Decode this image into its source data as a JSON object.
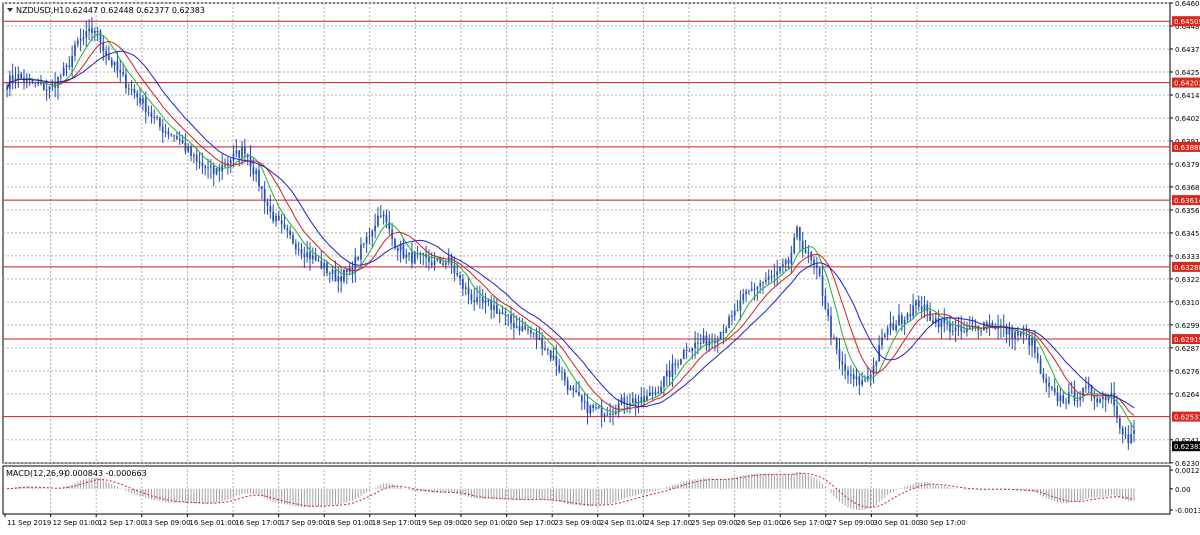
{
  "header": {
    "symbol_label": "NZDUSD,H1",
    "ohlc": "0.62447 0.62448 0.62377 0.62383"
  },
  "macd_header": {
    "label": "MACD(12,26,9)",
    "values": "-0.000843 -0.000663"
  },
  "colors": {
    "background": "#ffffff",
    "grid": "#b0b0b0",
    "candles": "#1f4fb4",
    "ma_fast": "#2bb02b",
    "ma_mid": "#d02020",
    "ma_slow": "#2020c0",
    "level_line": "#c81e1e",
    "level_tag_bg": "#d8281e",
    "current_tag_bg": "#000000",
    "macd_hist": "#a0a0a0",
    "macd_signal": "#d02020"
  },
  "chart_data": [
    {
      "type": "candlestick",
      "symbol": "NZDUSD",
      "timeframe": "H1",
      "ylim": [
        0.62299,
        0.646
      ],
      "y_ticks": [
        "0.64600",
        "0.64485",
        "0.64370",
        "0.64255",
        "0.64140",
        "0.64025",
        "0.63910",
        "0.63795",
        "0.63680",
        "0.63565",
        "0.63450",
        "0.63335",
        "0.63220",
        "0.63105",
        "0.62990",
        "0.62875",
        "0.62760",
        "0.62645",
        "0.62415",
        "0.62300"
      ],
      "x_ticks": [
        "11 Sep 2019",
        "12 Sep 01:00",
        "12 Sep 17:00",
        "13 Sep 09:00",
        "16 Sep 01:00",
        "16 Sep 17:00",
        "17 Sep 09:00",
        "18 Sep 01:00",
        "18 Sep 17:00",
        "19 Sep 09:00",
        "20 Sep 01:00",
        "20 Sep 17:00",
        "23 Sep 09:00",
        "24 Sep 01:00",
        "24 Sep 17:00",
        "25 Sep 09:00",
        "26 Sep 01:00",
        "26 Sep 17:00",
        "27 Sep 09:00",
        "30 Sep 01:00",
        "30 Sep 17:00"
      ],
      "horizontal_levels": [
        "0.64509",
        "0.64202",
        "0.63880",
        "0.63614",
        "0.63280",
        "0.62919",
        "0.62531"
      ],
      "current_price": "0.62383",
      "close_path": [
        [
          0,
          0.642
        ],
        [
          3,
          0.6424
        ],
        [
          8,
          0.642
        ],
        [
          15,
          0.6417
        ],
        [
          21,
          0.6427
        ],
        [
          25,
          0.644
        ],
        [
          31,
          0.6447
        ],
        [
          36,
          0.6432
        ],
        [
          42,
          0.642
        ],
        [
          48,
          0.641
        ],
        [
          54,
          0.6398
        ],
        [
          60,
          0.6393
        ],
        [
          67,
          0.638
        ],
        [
          73,
          0.6375
        ],
        [
          79,
          0.6382
        ],
        [
          84,
          0.6387
        ],
        [
          89,
          0.637
        ],
        [
          93,
          0.6355
        ],
        [
          98,
          0.6345
        ],
        [
          104,
          0.6337
        ],
        [
          110,
          0.633
        ],
        [
          116,
          0.6323
        ],
        [
          121,
          0.6325
        ],
        [
          127,
          0.6342
        ],
        [
          132,
          0.6356
        ],
        [
          136,
          0.6342
        ],
        [
          141,
          0.6333
        ],
        [
          146,
          0.6332
        ],
        [
          151,
          0.633
        ],
        [
          156,
          0.6331
        ],
        [
          161,
          0.6318
        ],
        [
          166,
          0.631
        ],
        [
          172,
          0.6308
        ],
        [
          178,
          0.63
        ],
        [
          184,
          0.6296
        ],
        [
          189,
          0.629
        ],
        [
          194,
          0.628
        ],
        [
          199,
          0.6266
        ],
        [
          204,
          0.6258
        ],
        [
          209,
          0.6256
        ],
        [
          214,
          0.6257
        ],
        [
          219,
          0.6262
        ],
        [
          224,
          0.626
        ],
        [
          229,
          0.6266
        ],
        [
          234,
          0.6275
        ],
        [
          240,
          0.6288
        ],
        [
          245,
          0.629
        ],
        [
          250,
          0.6293
        ],
        [
          256,
          0.6302
        ],
        [
          261,
          0.6314
        ],
        [
          266,
          0.632
        ],
        [
          271,
          0.6323
        ],
        [
          276,
          0.633
        ],
        [
          279,
          0.6345
        ],
        [
          283,
          0.6333
        ],
        [
          287,
          0.6322
        ],
        [
          291,
          0.6295
        ],
        [
          294,
          0.628
        ],
        [
          298,
          0.6272
        ],
        [
          302,
          0.627
        ],
        [
          306,
          0.6278
        ],
        [
          310,
          0.6295
        ],
        [
          314,
          0.63
        ],
        [
          318,
          0.6305
        ],
        [
          322,
          0.631
        ],
        [
          326,
          0.6303
        ],
        [
          330,
          0.63
        ],
        [
          334,
          0.6297
        ],
        [
          338,
          0.6295
        ],
        [
          342,
          0.6298
        ],
        [
          346,
          0.63
        ],
        [
          350,
          0.6298
        ],
        [
          354,
          0.6295
        ],
        [
          358,
          0.6294
        ],
        [
          362,
          0.629
        ],
        [
          366,
          0.627
        ],
        [
          370,
          0.6263
        ],
        [
          374,
          0.6262
        ],
        [
          378,
          0.6264
        ],
        [
          382,
          0.6266
        ],
        [
          386,
          0.6262
        ],
        [
          390,
          0.6265
        ],
        [
          393,
          0.625
        ],
        [
          396,
          0.624
        ],
        [
          398,
          0.6245
        ]
      ],
      "moving_averages": [
        {
          "period": 8,
          "color": "#2bb02b"
        },
        {
          "period": 14,
          "color": "#d02020"
        },
        {
          "period": 22,
          "color": "#2020c0"
        }
      ]
    },
    {
      "type": "macd",
      "params": "12,26,9",
      "ylim": [
        -0.00135,
        0.0012
      ],
      "y_ticks": [
        "0.00120",
        "0.00",
        "-0.00135"
      ]
    }
  ]
}
